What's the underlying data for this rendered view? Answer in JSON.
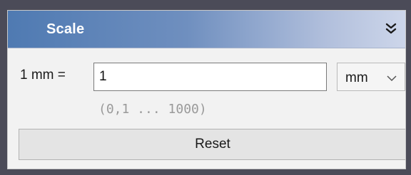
{
  "panel": {
    "title": "Scale",
    "collapse_icon": "double-chevron-down-icon"
  },
  "scale": {
    "label": "1 mm =",
    "value": "1",
    "unit": "mm",
    "range_hint": "(0,1 ... 1000)"
  },
  "reset": {
    "label": "Reset"
  },
  "colors": {
    "header_start": "#4f7ab2",
    "header_end": "#cdd6ea",
    "panel_bg": "#f2f2f2",
    "window_bg": "#4b4b58"
  }
}
